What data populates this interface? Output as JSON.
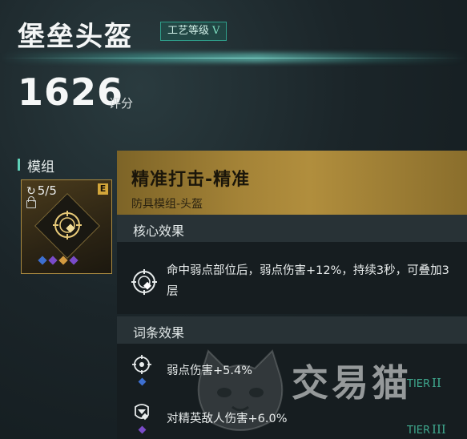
{
  "header": {
    "item_name": "堡垒头盔",
    "craft_label": "工艺等级",
    "craft_level": "V",
    "score": "1626",
    "score_unit": "评分"
  },
  "module_section": {
    "label": "模组",
    "count": "5/5",
    "grade": "E",
    "gems": [
      "#3d6fd0",
      "#7a4bc8",
      "#d39a40",
      "#7a4bc8"
    ]
  },
  "detail": {
    "name": "精准打击-精准",
    "type": "防具模组-头盔",
    "core_title": "核心效果",
    "core_text": "命中弱点部位后，弱点伤害+12%，持续3秒，可叠加3层",
    "affix_title": "词条效果",
    "affixes": [
      {
        "text": "弱点伤害+5.4%",
        "tier_label": "TIER",
        "tier": "II",
        "gem": "#3d6fd0"
      },
      {
        "text": "对精英敌人伤害+6.0%",
        "tier_label": "TIER",
        "tier": "III",
        "gem": "#7a4bc8"
      }
    ]
  },
  "watermark": "交易猫"
}
